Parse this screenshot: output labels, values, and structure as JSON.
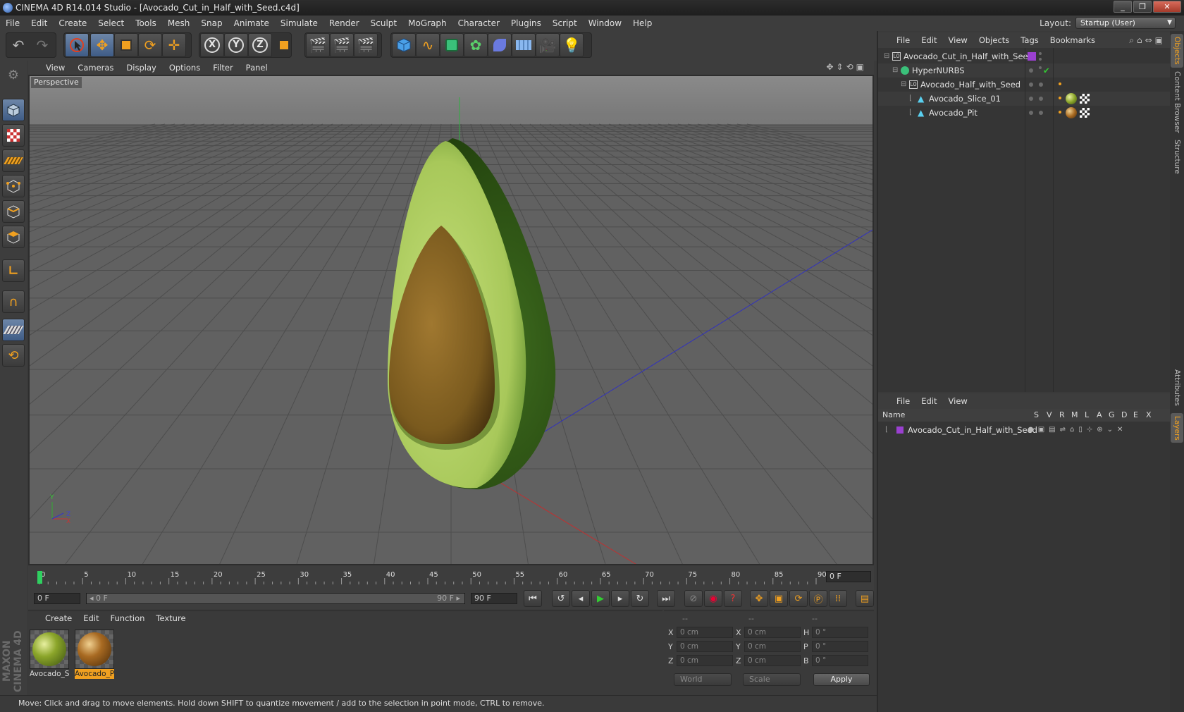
{
  "window": {
    "title": "CINEMA 4D R14.014 Studio - [Avocado_Cut_in_Half_with_Seed.c4d]",
    "buttons": [
      "_",
      "❐",
      "✕"
    ]
  },
  "menubar": {
    "items": [
      "File",
      "Edit",
      "Create",
      "Select",
      "Tools",
      "Mesh",
      "Snap",
      "Animate",
      "Simulate",
      "Render",
      "Sculpt",
      "MoGraph",
      "Character",
      "Plugins",
      "Script",
      "Window",
      "Help"
    ],
    "layout_label": "Layout:",
    "layout_value": "Startup (User)"
  },
  "toolbar": {
    "icons": [
      "undo-icon",
      "redo-icon",
      "live-selection-icon",
      "move-icon",
      "scale-icon",
      "rotate-icon",
      "add-icon",
      "x-axis-icon",
      "y-axis-icon",
      "z-axis-icon",
      "coordinate-system-icon",
      "render-view-icon",
      "render-picture-viewer-icon",
      "edit-render-settings-icon",
      "cube-icon",
      "spline-icon",
      "nurbs-icon",
      "array-icon",
      "deformer-icon",
      "floor-icon",
      "camera-icon",
      "light-icon"
    ],
    "axis_labels": [
      "X",
      "Y",
      "Z"
    ]
  },
  "viewport": {
    "menu": [
      "View",
      "Cameras",
      "Display",
      "Options",
      "Filter",
      "Panel"
    ],
    "label": "Perspective",
    "axis_gizmo": {
      "y": "Y",
      "x": "X",
      "z": "Z"
    }
  },
  "timeline": {
    "ticks": [
      "0",
      "5",
      "10",
      "15",
      "20",
      "25",
      "30",
      "35",
      "40",
      "45",
      "50",
      "55",
      "60",
      "65",
      "70",
      "75",
      "80",
      "85",
      "90"
    ],
    "current_frame": "0 F"
  },
  "transport": {
    "start": "0 F",
    "range_start": "◂ 0 F",
    "range_end": "90 F ▸",
    "end": "90 F"
  },
  "materials": {
    "menu": [
      "Create",
      "Edit",
      "Function",
      "Texture"
    ],
    "items": [
      {
        "name": "Avocado_S",
        "color": "#8ba52a",
        "selected": false
      },
      {
        "name": "Avocado_P",
        "color": "#a86a22",
        "selected": true
      }
    ]
  },
  "coordinates": {
    "headers": [
      "--",
      "--",
      "--"
    ],
    "rows": [
      {
        "axis": "X",
        "pos": "0 cm",
        "size_axis": "X",
        "size": "0 cm",
        "rot_axis": "H",
        "rot": "0 °"
      },
      {
        "axis": "Y",
        "pos": "0 cm",
        "size_axis": "Y",
        "size": "0 cm",
        "rot_axis": "P",
        "rot": "0 °"
      },
      {
        "axis": "Z",
        "pos": "0 cm",
        "size_axis": "Z",
        "size": "0 cm",
        "rot_axis": "B",
        "rot": "0 °"
      }
    ],
    "mode1": "World",
    "mode2": "Scale",
    "apply": "Apply"
  },
  "status": "Move: Click and drag to move elements. Hold down SHIFT to quantize movement / add to the selection in point mode, CTRL to remove.",
  "brand": "MAXON CINEMA 4D",
  "objects_panel": {
    "menu": [
      "File",
      "Edit",
      "View",
      "Objects",
      "Tags",
      "Bookmarks"
    ],
    "items": [
      {
        "name": "Avocado_Cut_in_Half_with_Seed",
        "depth": 0,
        "icon": "null-icon"
      },
      {
        "name": "HyperNURBS",
        "depth": 1,
        "icon": "hypernurbs-icon"
      },
      {
        "name": "Avocado_Half_with_Seed",
        "depth": 2,
        "icon": "null-icon"
      },
      {
        "name": "Avocado_Slice_01",
        "depth": 3,
        "icon": "polygon-icon"
      },
      {
        "name": "Avocado_Pit",
        "depth": 3,
        "icon": "polygon-icon"
      }
    ]
  },
  "layers_panel": {
    "menu": [
      "File",
      "Edit",
      "View"
    ],
    "header_name": "Name",
    "columns": [
      "S",
      "V",
      "R",
      "M",
      "L",
      "A",
      "G",
      "D",
      "E",
      "X"
    ],
    "items": [
      {
        "name": "Avocado_Cut_in_Half_with_Seed",
        "color": "#9a40d0"
      }
    ]
  },
  "side_tabs": [
    "Objects",
    "Content Browser",
    "Structure",
    "Attributes",
    "Layers"
  ],
  "colors": {
    "accent": "#f0a020",
    "selection": "#4f6f9a",
    "layer": "#9a40d0"
  }
}
